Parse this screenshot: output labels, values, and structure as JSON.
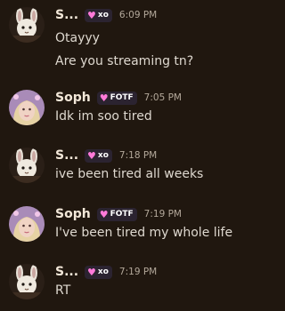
{
  "messages": [
    {
      "author": "S...",
      "tag": "xo",
      "time": "6:09 PM",
      "avatar": "bunny-avatar",
      "lines": [
        "Otayyy",
        "Are you streaming tn?"
      ]
    },
    {
      "author": "Soph",
      "tag": "FOTF",
      "time": "7:05 PM",
      "avatar": "soph-avatar",
      "lines": [
        "Idk im soo tired"
      ]
    },
    {
      "author": "S...",
      "tag": "xo",
      "time": "7:18 PM",
      "avatar": "bunny-avatar",
      "lines": [
        "ive been tired all weeks"
      ]
    },
    {
      "author": "Soph",
      "tag": "FOTF",
      "time": "7:19 PM",
      "avatar": "soph-avatar",
      "lines": [
        "I've been tired my whole life"
      ]
    },
    {
      "author": "S...",
      "tag": "xo",
      "time": "7:19 PM",
      "avatar": "bunny-avatar",
      "lines": [
        "RT"
      ]
    }
  ],
  "colors": {
    "background": "#20170f",
    "tag_heart": "#ff7ad9",
    "username": "#f2e7d8"
  }
}
